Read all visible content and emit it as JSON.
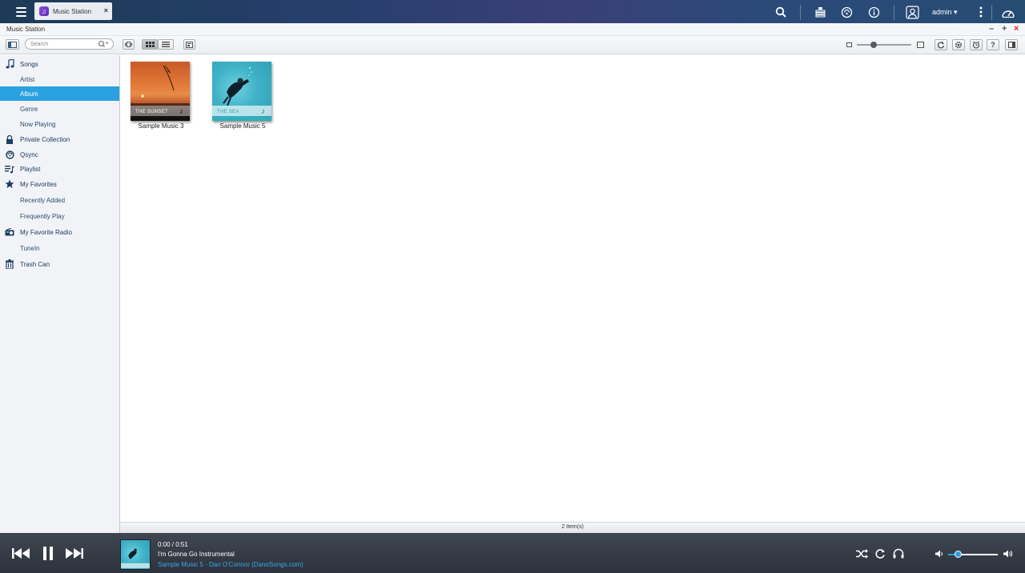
{
  "topbar": {
    "app_tab_label": "Music Station",
    "user": "admin"
  },
  "app_header": {
    "title": "Music Station"
  },
  "toolbar": {
    "search_placeholder": "Search"
  },
  "sidebar": {
    "items": [
      {
        "label": "Songs",
        "icon": "music-note-icon"
      },
      {
        "label": "Artist"
      },
      {
        "label": "Album"
      },
      {
        "label": "Genre"
      },
      {
        "label": "Now Playing"
      },
      {
        "label": "Private Collection",
        "icon": "lock-icon"
      },
      {
        "label": "Qsync",
        "icon": "qsync-icon"
      },
      {
        "label": "Playlist",
        "icon": "playlist-icon"
      },
      {
        "label": "My Favorites",
        "icon": "star-icon"
      },
      {
        "label": "Recently Added"
      },
      {
        "label": "Frequently Play"
      },
      {
        "label": "My Favorite Radio",
        "icon": "radio-icon"
      },
      {
        "label": "TuneIn"
      },
      {
        "label": "Trash Can",
        "icon": "trash-icon"
      }
    ],
    "selected": "Album"
  },
  "albums": [
    {
      "title": "Sample Music 3",
      "cover_text": "THE SUNSET"
    },
    {
      "title": "Sample Music 5",
      "cover_text": "THE SEA"
    }
  ],
  "status": {
    "items_count": "2 Item(s)"
  },
  "player": {
    "time": "0:00 / 0:51",
    "track": "I'm Gonna Go Instrumental",
    "artist_album": "Sample Music 5 - Dan O'Connor (DanoSongs.com)",
    "volume": 0.2
  },
  "colors": {
    "accent": "#2aa1e0",
    "player_bg": "#353b45",
    "link": "#39a6ea"
  }
}
